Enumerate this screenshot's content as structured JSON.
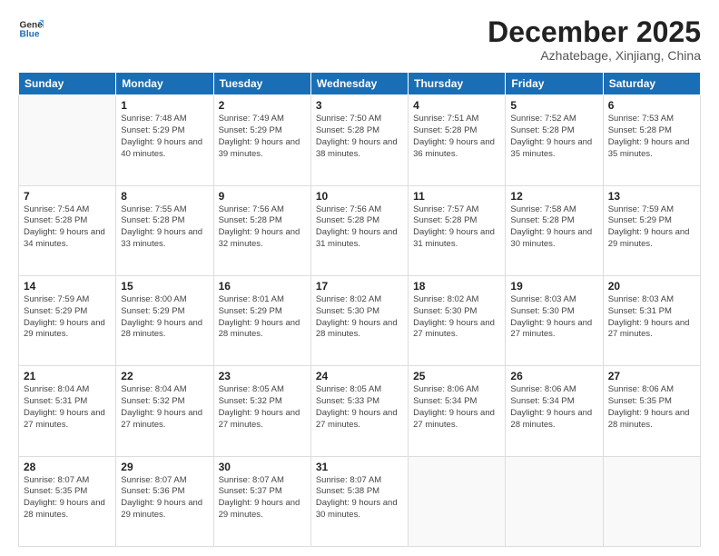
{
  "logo": {
    "line1": "General",
    "line2": "Blue"
  },
  "header": {
    "title": "December 2025",
    "subtitle": "Azhatebage, Xinjiang, China"
  },
  "weekdays": [
    "Sunday",
    "Monday",
    "Tuesday",
    "Wednesday",
    "Thursday",
    "Friday",
    "Saturday"
  ],
  "weeks": [
    [
      {
        "day": "",
        "empty": true
      },
      {
        "day": "1",
        "sunrise": "7:48 AM",
        "sunset": "5:29 PM",
        "daylight": "9 hours and 40 minutes."
      },
      {
        "day": "2",
        "sunrise": "7:49 AM",
        "sunset": "5:29 PM",
        "daylight": "9 hours and 39 minutes."
      },
      {
        "day": "3",
        "sunrise": "7:50 AM",
        "sunset": "5:28 PM",
        "daylight": "9 hours and 38 minutes."
      },
      {
        "day": "4",
        "sunrise": "7:51 AM",
        "sunset": "5:28 PM",
        "daylight": "9 hours and 36 minutes."
      },
      {
        "day": "5",
        "sunrise": "7:52 AM",
        "sunset": "5:28 PM",
        "daylight": "9 hours and 35 minutes."
      },
      {
        "day": "6",
        "sunrise": "7:53 AM",
        "sunset": "5:28 PM",
        "daylight": "9 hours and 35 minutes."
      }
    ],
    [
      {
        "day": "7",
        "sunrise": "7:54 AM",
        "sunset": "5:28 PM",
        "daylight": "9 hours and 34 minutes."
      },
      {
        "day": "8",
        "sunrise": "7:55 AM",
        "sunset": "5:28 PM",
        "daylight": "9 hours and 33 minutes."
      },
      {
        "day": "9",
        "sunrise": "7:56 AM",
        "sunset": "5:28 PM",
        "daylight": "9 hours and 32 minutes."
      },
      {
        "day": "10",
        "sunrise": "7:56 AM",
        "sunset": "5:28 PM",
        "daylight": "9 hours and 31 minutes."
      },
      {
        "day": "11",
        "sunrise": "7:57 AM",
        "sunset": "5:28 PM",
        "daylight": "9 hours and 31 minutes."
      },
      {
        "day": "12",
        "sunrise": "7:58 AM",
        "sunset": "5:28 PM",
        "daylight": "9 hours and 30 minutes."
      },
      {
        "day": "13",
        "sunrise": "7:59 AM",
        "sunset": "5:29 PM",
        "daylight": "9 hours and 29 minutes."
      }
    ],
    [
      {
        "day": "14",
        "sunrise": "7:59 AM",
        "sunset": "5:29 PM",
        "daylight": "9 hours and 29 minutes."
      },
      {
        "day": "15",
        "sunrise": "8:00 AM",
        "sunset": "5:29 PM",
        "daylight": "9 hours and 28 minutes."
      },
      {
        "day": "16",
        "sunrise": "8:01 AM",
        "sunset": "5:29 PM",
        "daylight": "9 hours and 28 minutes."
      },
      {
        "day": "17",
        "sunrise": "8:02 AM",
        "sunset": "5:30 PM",
        "daylight": "9 hours and 28 minutes."
      },
      {
        "day": "18",
        "sunrise": "8:02 AM",
        "sunset": "5:30 PM",
        "daylight": "9 hours and 27 minutes."
      },
      {
        "day": "19",
        "sunrise": "8:03 AM",
        "sunset": "5:30 PM",
        "daylight": "9 hours and 27 minutes."
      },
      {
        "day": "20",
        "sunrise": "8:03 AM",
        "sunset": "5:31 PM",
        "daylight": "9 hours and 27 minutes."
      }
    ],
    [
      {
        "day": "21",
        "sunrise": "8:04 AM",
        "sunset": "5:31 PM",
        "daylight": "9 hours and 27 minutes."
      },
      {
        "day": "22",
        "sunrise": "8:04 AM",
        "sunset": "5:32 PM",
        "daylight": "9 hours and 27 minutes."
      },
      {
        "day": "23",
        "sunrise": "8:05 AM",
        "sunset": "5:32 PM",
        "daylight": "9 hours and 27 minutes."
      },
      {
        "day": "24",
        "sunrise": "8:05 AM",
        "sunset": "5:33 PM",
        "daylight": "9 hours and 27 minutes."
      },
      {
        "day": "25",
        "sunrise": "8:06 AM",
        "sunset": "5:34 PM",
        "daylight": "9 hours and 27 minutes."
      },
      {
        "day": "26",
        "sunrise": "8:06 AM",
        "sunset": "5:34 PM",
        "daylight": "9 hours and 28 minutes."
      },
      {
        "day": "27",
        "sunrise": "8:06 AM",
        "sunset": "5:35 PM",
        "daylight": "9 hours and 28 minutes."
      }
    ],
    [
      {
        "day": "28",
        "sunrise": "8:07 AM",
        "sunset": "5:35 PM",
        "daylight": "9 hours and 28 minutes."
      },
      {
        "day": "29",
        "sunrise": "8:07 AM",
        "sunset": "5:36 PM",
        "daylight": "9 hours and 29 minutes."
      },
      {
        "day": "30",
        "sunrise": "8:07 AM",
        "sunset": "5:37 PM",
        "daylight": "9 hours and 29 minutes."
      },
      {
        "day": "31",
        "sunrise": "8:07 AM",
        "sunset": "5:38 PM",
        "daylight": "9 hours and 30 minutes."
      },
      {
        "day": "",
        "empty": true
      },
      {
        "day": "",
        "empty": true
      },
      {
        "day": "",
        "empty": true
      }
    ]
  ]
}
